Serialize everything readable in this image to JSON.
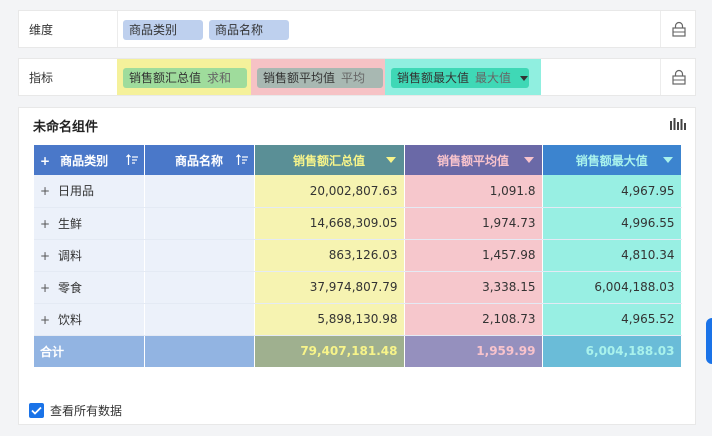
{
  "dimension_row": {
    "label": "维度",
    "fields": [
      "商品类别",
      "商品名称"
    ]
  },
  "metric_row": {
    "label": "指标",
    "fields": [
      {
        "name": "销售额汇总值",
        "agg": "求和",
        "color": "#f5f19b"
      },
      {
        "name": "销售额平均值",
        "agg": "平均",
        "color": "#f6c2c5"
      },
      {
        "name": "销售额最大值",
        "agg": "最大值",
        "color": "#90efe0"
      }
    ]
  },
  "widget": {
    "title": "未命名组件",
    "columns": [
      {
        "label": "商品类别",
        "color": "#4a78c9"
      },
      {
        "label": "商品名称",
        "color": "#4a78c9"
      },
      {
        "label": "销售额汇总值",
        "color": "#5a8f96",
        "text_color": "#f7f48a"
      },
      {
        "label": "销售额平均值",
        "color": "#6a69a7",
        "text_color": "#f8c3cc"
      },
      {
        "label": "销售额最大值",
        "color": "#3c84cf",
        "text_color": "#a9f2ec"
      }
    ],
    "rows": [
      {
        "category": "日用品",
        "sum": "20,002,807.63",
        "avg": "1,091.8",
        "max": "4,967.95"
      },
      {
        "category": "生鲜",
        "sum": "14,668,309.05",
        "avg": "1,974.73",
        "max": "4,996.55"
      },
      {
        "category": "调料",
        "sum": "863,126.03",
        "avg": "1,457.98",
        "max": "4,810.34"
      },
      {
        "category": "零食",
        "sum": "37,974,807.79",
        "avg": "3,338.15",
        "max": "6,004,188.03"
      },
      {
        "category": "饮料",
        "sum": "5,898,130.98",
        "avg": "2,108.73",
        "max": "4,965.52"
      }
    ],
    "total": {
      "label": "合计",
      "sum": "79,407,181.48",
      "avg": "1,959.99",
      "max": "6,004,188.03"
    },
    "view_all_label": "查看所有数据",
    "view_all_checked": true
  }
}
